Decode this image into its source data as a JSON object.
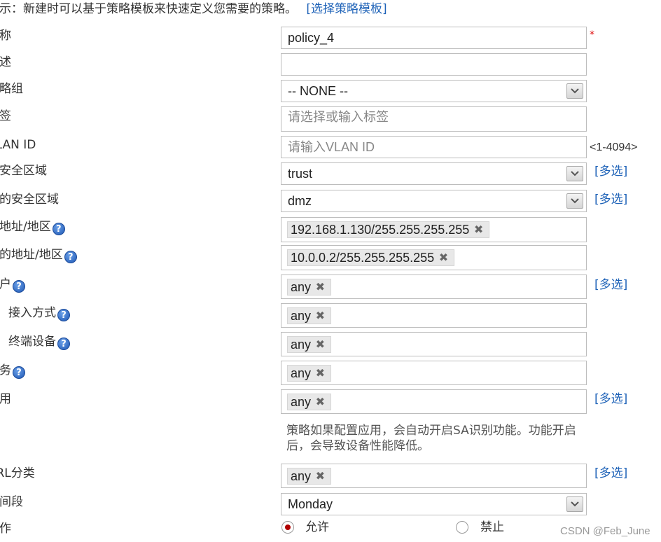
{
  "hint": {
    "text": "提示：新建时可以基于策略模板来快速定义您需要的策略。",
    "link": "[选择策略模板]"
  },
  "fields": {
    "name": {
      "label": "名称",
      "value": "policy_4",
      "required_mark": "*"
    },
    "description": {
      "label": "描述",
      "value": ""
    },
    "policy_group": {
      "label": "策略组",
      "value": "-- NONE --"
    },
    "tags": {
      "label": "标签",
      "placeholder": "请选择或输入标签"
    },
    "vlan_id": {
      "label": "VLAN ID",
      "placeholder": "请输入VLAN ID",
      "range": "<1-4094>"
    },
    "src_zone": {
      "label": "源安全区域",
      "value": "trust",
      "multi": "[多选]"
    },
    "dst_zone": {
      "label": "目的安全区域",
      "value": "dmz",
      "multi": "[多选]"
    },
    "src_addr": {
      "label": "源地址/地区",
      "tag": "192.168.1.130/255.255.255.255"
    },
    "dst_addr": {
      "label": "目的地址/地区",
      "tag": "10.0.0.2/255.255.255.255"
    },
    "user": {
      "label": "用户",
      "tag": "any",
      "multi": "[多选]"
    },
    "access_method": {
      "label": "接入方式",
      "tag": "any"
    },
    "terminal_device": {
      "label": "终端设备",
      "tag": "any"
    },
    "service": {
      "label": "服务",
      "tag": "any"
    },
    "application": {
      "label": "应用",
      "tag": "any",
      "multi": "[多选]",
      "note_line1": "策略如果配置应用，会自动开启SA识别功能。功能开启",
      "note_line2": "后，会导致设备性能降低。"
    },
    "url_category": {
      "label": "URL分类",
      "tag": "any",
      "multi": "[多选]"
    },
    "time_range": {
      "label": "时间段",
      "value": "Monday"
    },
    "action": {
      "label": "动作",
      "allow": "允许",
      "deny": "禁止",
      "selected": "允许"
    }
  },
  "help_glyph": "?",
  "remove_glyph": "✖",
  "watermark": "CSDN @Feb_June"
}
